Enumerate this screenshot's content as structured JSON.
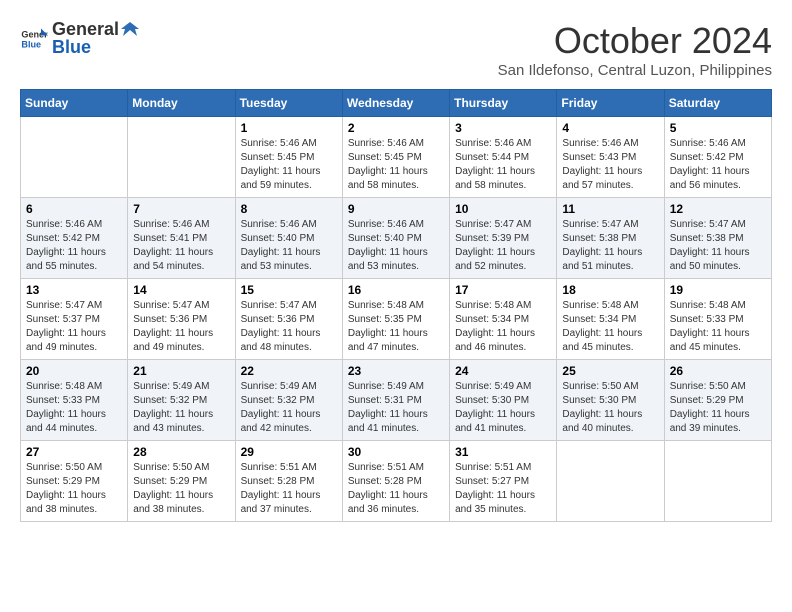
{
  "logo": {
    "general": "General",
    "blue": "Blue"
  },
  "header": {
    "month": "October 2024",
    "location": "San Ildefonso, Central Luzon, Philippines"
  },
  "weekdays": [
    "Sunday",
    "Monday",
    "Tuesday",
    "Wednesday",
    "Thursday",
    "Friday",
    "Saturday"
  ],
  "weeks": [
    [
      null,
      null,
      {
        "day": "1",
        "sunrise": "Sunrise: 5:46 AM",
        "sunset": "Sunset: 5:45 PM",
        "daylight": "Daylight: 11 hours and 59 minutes."
      },
      {
        "day": "2",
        "sunrise": "Sunrise: 5:46 AM",
        "sunset": "Sunset: 5:45 PM",
        "daylight": "Daylight: 11 hours and 58 minutes."
      },
      {
        "day": "3",
        "sunrise": "Sunrise: 5:46 AM",
        "sunset": "Sunset: 5:44 PM",
        "daylight": "Daylight: 11 hours and 58 minutes."
      },
      {
        "day": "4",
        "sunrise": "Sunrise: 5:46 AM",
        "sunset": "Sunset: 5:43 PM",
        "daylight": "Daylight: 11 hours and 57 minutes."
      },
      {
        "day": "5",
        "sunrise": "Sunrise: 5:46 AM",
        "sunset": "Sunset: 5:42 PM",
        "daylight": "Daylight: 11 hours and 56 minutes."
      }
    ],
    [
      {
        "day": "6",
        "sunrise": "Sunrise: 5:46 AM",
        "sunset": "Sunset: 5:42 PM",
        "daylight": "Daylight: 11 hours and 55 minutes."
      },
      {
        "day": "7",
        "sunrise": "Sunrise: 5:46 AM",
        "sunset": "Sunset: 5:41 PM",
        "daylight": "Daylight: 11 hours and 54 minutes."
      },
      {
        "day": "8",
        "sunrise": "Sunrise: 5:46 AM",
        "sunset": "Sunset: 5:40 PM",
        "daylight": "Daylight: 11 hours and 53 minutes."
      },
      {
        "day": "9",
        "sunrise": "Sunrise: 5:46 AM",
        "sunset": "Sunset: 5:40 PM",
        "daylight": "Daylight: 11 hours and 53 minutes."
      },
      {
        "day": "10",
        "sunrise": "Sunrise: 5:47 AM",
        "sunset": "Sunset: 5:39 PM",
        "daylight": "Daylight: 11 hours and 52 minutes."
      },
      {
        "day": "11",
        "sunrise": "Sunrise: 5:47 AM",
        "sunset": "Sunset: 5:38 PM",
        "daylight": "Daylight: 11 hours and 51 minutes."
      },
      {
        "day": "12",
        "sunrise": "Sunrise: 5:47 AM",
        "sunset": "Sunset: 5:38 PM",
        "daylight": "Daylight: 11 hours and 50 minutes."
      }
    ],
    [
      {
        "day": "13",
        "sunrise": "Sunrise: 5:47 AM",
        "sunset": "Sunset: 5:37 PM",
        "daylight": "Daylight: 11 hours and 49 minutes."
      },
      {
        "day": "14",
        "sunrise": "Sunrise: 5:47 AM",
        "sunset": "Sunset: 5:36 PM",
        "daylight": "Daylight: 11 hours and 49 minutes."
      },
      {
        "day": "15",
        "sunrise": "Sunrise: 5:47 AM",
        "sunset": "Sunset: 5:36 PM",
        "daylight": "Daylight: 11 hours and 48 minutes."
      },
      {
        "day": "16",
        "sunrise": "Sunrise: 5:48 AM",
        "sunset": "Sunset: 5:35 PM",
        "daylight": "Daylight: 11 hours and 47 minutes."
      },
      {
        "day": "17",
        "sunrise": "Sunrise: 5:48 AM",
        "sunset": "Sunset: 5:34 PM",
        "daylight": "Daylight: 11 hours and 46 minutes."
      },
      {
        "day": "18",
        "sunrise": "Sunrise: 5:48 AM",
        "sunset": "Sunset: 5:34 PM",
        "daylight": "Daylight: 11 hours and 45 minutes."
      },
      {
        "day": "19",
        "sunrise": "Sunrise: 5:48 AM",
        "sunset": "Sunset: 5:33 PM",
        "daylight": "Daylight: 11 hours and 45 minutes."
      }
    ],
    [
      {
        "day": "20",
        "sunrise": "Sunrise: 5:48 AM",
        "sunset": "Sunset: 5:33 PM",
        "daylight": "Daylight: 11 hours and 44 minutes."
      },
      {
        "day": "21",
        "sunrise": "Sunrise: 5:49 AM",
        "sunset": "Sunset: 5:32 PM",
        "daylight": "Daylight: 11 hours and 43 minutes."
      },
      {
        "day": "22",
        "sunrise": "Sunrise: 5:49 AM",
        "sunset": "Sunset: 5:32 PM",
        "daylight": "Daylight: 11 hours and 42 minutes."
      },
      {
        "day": "23",
        "sunrise": "Sunrise: 5:49 AM",
        "sunset": "Sunset: 5:31 PM",
        "daylight": "Daylight: 11 hours and 41 minutes."
      },
      {
        "day": "24",
        "sunrise": "Sunrise: 5:49 AM",
        "sunset": "Sunset: 5:30 PM",
        "daylight": "Daylight: 11 hours and 41 minutes."
      },
      {
        "day": "25",
        "sunrise": "Sunrise: 5:50 AM",
        "sunset": "Sunset: 5:30 PM",
        "daylight": "Daylight: 11 hours and 40 minutes."
      },
      {
        "day": "26",
        "sunrise": "Sunrise: 5:50 AM",
        "sunset": "Sunset: 5:29 PM",
        "daylight": "Daylight: 11 hours and 39 minutes."
      }
    ],
    [
      {
        "day": "27",
        "sunrise": "Sunrise: 5:50 AM",
        "sunset": "Sunset: 5:29 PM",
        "daylight": "Daylight: 11 hours and 38 minutes."
      },
      {
        "day": "28",
        "sunrise": "Sunrise: 5:50 AM",
        "sunset": "Sunset: 5:29 PM",
        "daylight": "Daylight: 11 hours and 38 minutes."
      },
      {
        "day": "29",
        "sunrise": "Sunrise: 5:51 AM",
        "sunset": "Sunset: 5:28 PM",
        "daylight": "Daylight: 11 hours and 37 minutes."
      },
      {
        "day": "30",
        "sunrise": "Sunrise: 5:51 AM",
        "sunset": "Sunset: 5:28 PM",
        "daylight": "Daylight: 11 hours and 36 minutes."
      },
      {
        "day": "31",
        "sunrise": "Sunrise: 5:51 AM",
        "sunset": "Sunset: 5:27 PM",
        "daylight": "Daylight: 11 hours and 35 minutes."
      },
      null,
      null
    ]
  ]
}
